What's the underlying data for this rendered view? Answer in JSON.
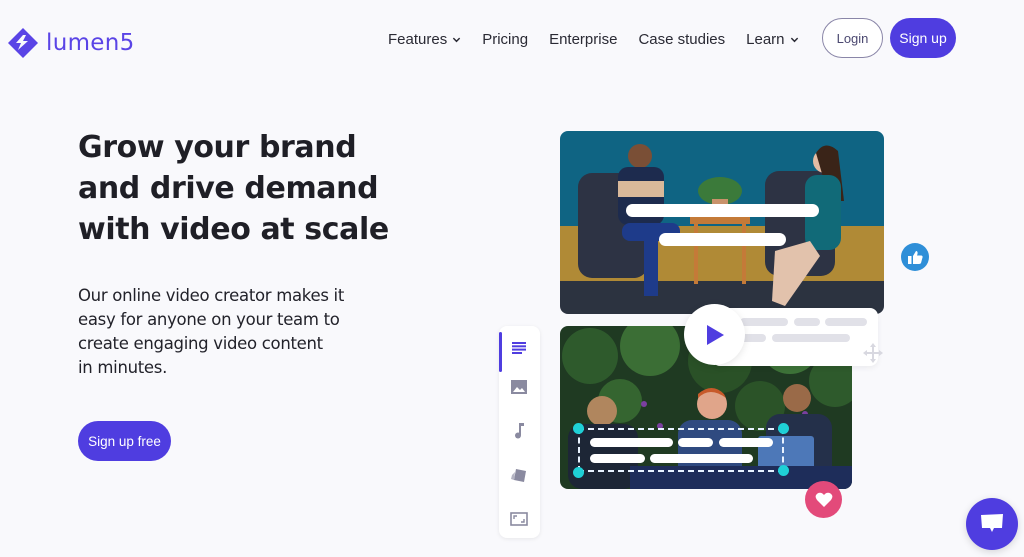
{
  "brand": {
    "name": "lumen5",
    "accent": "#4f3de0",
    "logo_icon": "lumen5-logo-icon"
  },
  "nav": {
    "items": [
      {
        "label": "Features",
        "has_dropdown": true
      },
      {
        "label": "Pricing",
        "has_dropdown": false
      },
      {
        "label": "Enterprise",
        "has_dropdown": false
      },
      {
        "label": "Case studies",
        "has_dropdown": false
      },
      {
        "label": "Learn",
        "has_dropdown": true
      }
    ],
    "login_label": "Login",
    "signup_label": "Sign up"
  },
  "hero": {
    "title_lines": [
      "Grow your brand",
      "and drive demand",
      "with video at scale"
    ],
    "subtitle_lines": [
      "Our online video creator makes it",
      "easy for anyone on your team to",
      "create engaging video content",
      "in minutes."
    ],
    "cta_label": "Sign up free"
  },
  "illustration": {
    "toolbar_icons": [
      "text-lines-icon",
      "image-icon",
      "music-note-icon",
      "brand-cards-icon",
      "resize-frame-icon"
    ],
    "active_tool": "text-lines-icon",
    "badges": {
      "like_color": "#2f8fd8",
      "heart_color": "#e34a7a",
      "handle_color": "#1fd0d6"
    }
  },
  "chat": {
    "icon": "chat-bubble-icon"
  }
}
